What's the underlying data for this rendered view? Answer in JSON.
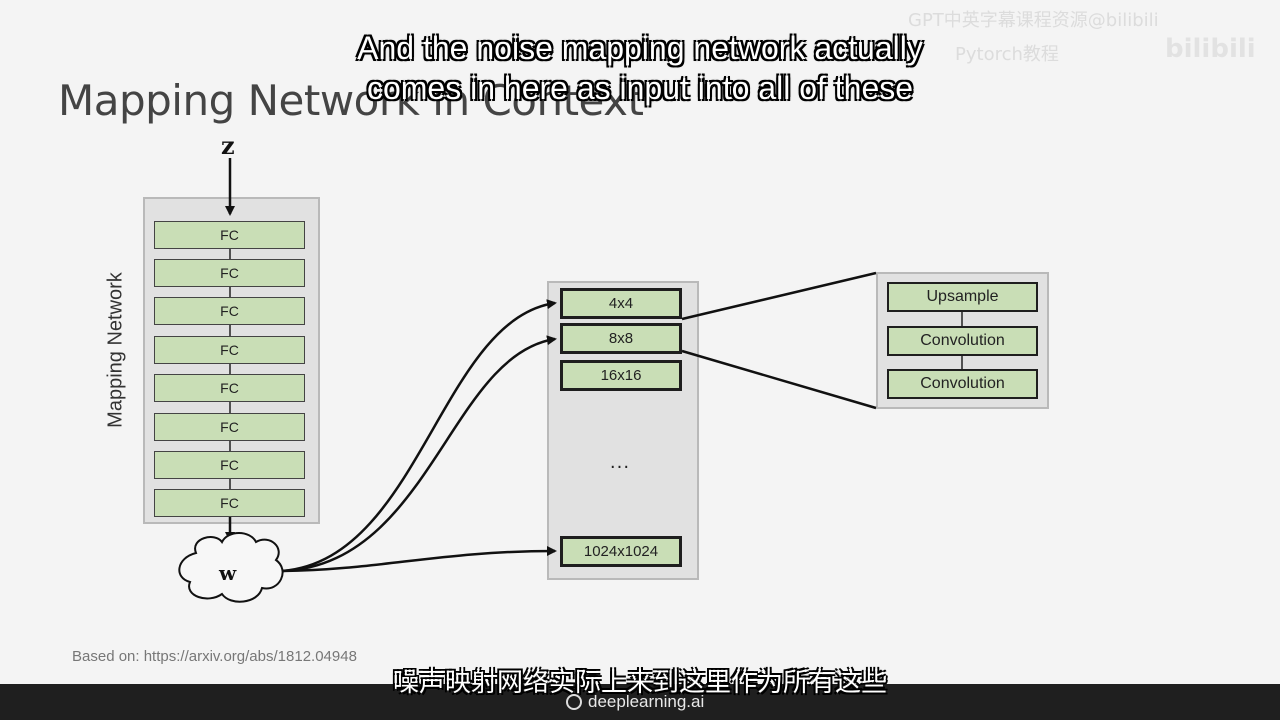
{
  "slide": {
    "title": "Mapping Network in Context",
    "citation": "Based on: https://arxiv.org/abs/1812.04948"
  },
  "diagram": {
    "input_label": "z",
    "latent_label": "w",
    "mapping_network_label": "Mapping Network",
    "fc_layers": [
      "FC",
      "FC",
      "FC",
      "FC",
      "FC",
      "FC",
      "FC",
      "FC"
    ],
    "resolutions": [
      "4x4",
      "8x8",
      "16x16",
      "1024x1024"
    ],
    "ellipsis": "...",
    "detail_blocks": [
      "Upsample",
      "Convolution",
      "Convolution"
    ]
  },
  "subtitles": {
    "en_line1": "And the noise mapping network actually",
    "en_line2": "comes in here as input into all of these",
    "zh": "噪声映射网络实际上来到这里作为所有这些"
  },
  "branding": {
    "name": "deeplearning.ai"
  },
  "watermark": {
    "line1": "GPT中英字幕课程资源@bilibili",
    "line2": "Pytorch教程",
    "logo": "bilibili"
  },
  "colors": {
    "block_fill": "#c9deb6",
    "panel_fill": "#e1e1e1",
    "background": "#f4f4f4"
  }
}
